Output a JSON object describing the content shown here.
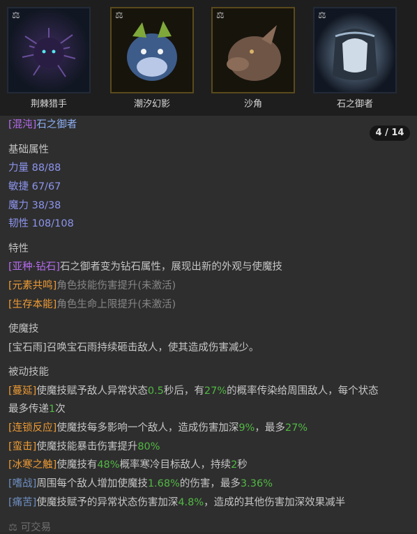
{
  "cards": [
    {
      "name": "荆棘猎手",
      "tag": "⚖"
    },
    {
      "name": "潮汐幻影",
      "tag": "⚖"
    },
    {
      "name": "沙角",
      "tag": "⚖"
    },
    {
      "name": "石之御者",
      "tag": "⚖"
    }
  ],
  "detail": {
    "rarity_tag": "[混沌]",
    "name": "石之御者",
    "pager": "4 / 14",
    "base_stats_heading": "基础属性",
    "stats": [
      "力量 88/88",
      "敏捷 67/67",
      "魔力 38/38",
      "韧性 108/108"
    ],
    "traits_heading": "特性",
    "traits": [
      {
        "tag": "[亚种·钻石]",
        "text": "石之御者变为钻石属性，展现出新的外观与使魔技"
      },
      {
        "tag": "[元素共鸣]",
        "text": "角色技能伤害提升(未激活)"
      },
      {
        "tag": "[生存本能]",
        "text": "角色生命上限提升(未激活)"
      }
    ],
    "skill_heading": "使魔技",
    "skill": {
      "tag": "[宝石雨]",
      "text": "召唤宝石雨持续砸击敌人，使其造成伤害减少。"
    },
    "passive_heading": "被动技能",
    "passives": {
      "p1": {
        "tag": "[蔓延]",
        "a": "使魔技赋予敌人异常状态",
        "v1": "0.5",
        "b": "秒后，有",
        "v2": "27%",
        "c": "的概率传染给周围敌人，每个状态"
      },
      "p1_cont": {
        "a": "最多传递",
        "v": "1",
        "b": "次"
      },
      "p2": {
        "tag": "[连锁反应]",
        "a": "使魔技每多影响一个敌人，造成伤害加深",
        "v1": "9%",
        "b": "，最多",
        "v2": "27%"
      },
      "p3": {
        "tag": "[蛮击]",
        "a": "使魔技能暴击伤害提升",
        "v": "80%"
      },
      "p4": {
        "tag": "[冰寒之触]",
        "a": "使魔技有",
        "v1": "48%",
        "b": "概率寒冷目标敌人，持续",
        "v2": "2",
        "c": "秒"
      },
      "p5": {
        "tag": "[嗜战]",
        "a": "周围每个敌人增加使魔技",
        "v1": "1.68%",
        "b": "的伤害，最多",
        "v2": "3.36%"
      },
      "p6": {
        "tag": "[痛苦]",
        "a": "使魔技赋予的异常状态伤害加深",
        "v": "4.8%",
        "b": "，造成的其他伤害加深效果减半"
      }
    },
    "tradable": {
      "icon": "⚖",
      "text": "可交易"
    }
  },
  "colors": {
    "stat": "#8d95ee",
    "chaos": "#b66cf0",
    "name": "#8fb0f5",
    "trait": "#ec9a34",
    "value": "#52b944",
    "inactive": "#868686"
  }
}
